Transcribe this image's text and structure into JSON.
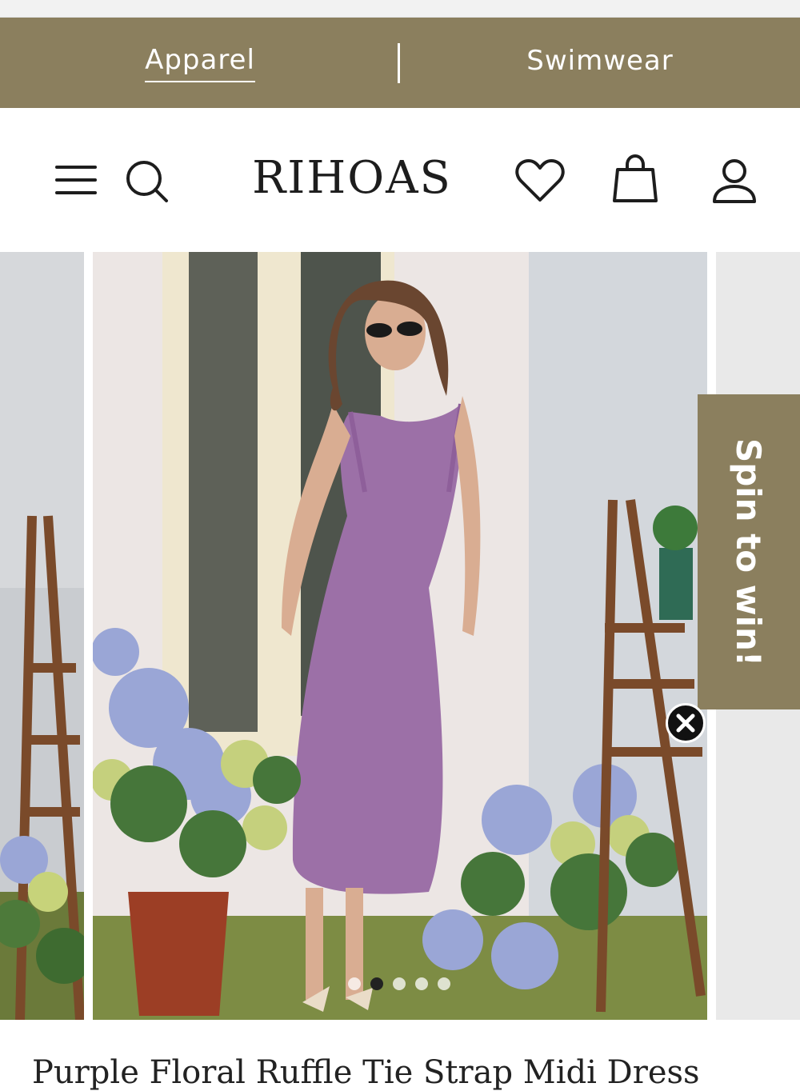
{
  "colors": {
    "accent": "#8b7f5e",
    "text_dark": "#1d1d1d",
    "close_bg": "#111111"
  },
  "category_bar": {
    "items": [
      {
        "label": "Apparel",
        "active": true
      },
      {
        "label": "Swimwear",
        "active": false
      }
    ]
  },
  "header": {
    "logo": "RIHOAS",
    "icons": [
      "menu-icon",
      "search-icon",
      "heart-icon",
      "shopping-bag-icon",
      "user-icon"
    ]
  },
  "carousel": {
    "total_slides": 5,
    "active_index": 1
  },
  "promo": {
    "label": "Spin to win!"
  },
  "product": {
    "title": "Purple Floral Ruffle Tie Strap Midi Dress"
  }
}
